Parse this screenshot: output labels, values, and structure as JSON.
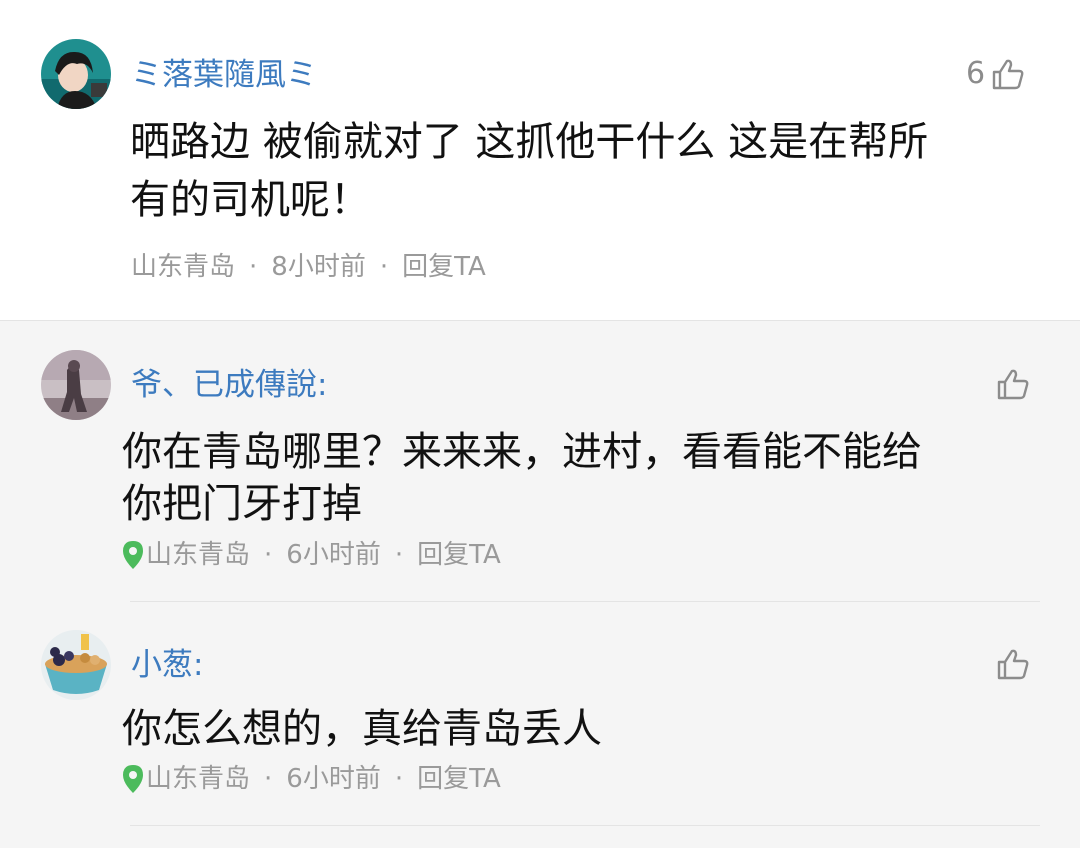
{
  "main_comment": {
    "username": "ミ落葉隨風ミ",
    "like_count": "6",
    "content_line1": "晒路边 被偷就对了 这抓他干什么 这是在帮所",
    "content_line2": "有的司机呢！",
    "location": "山东青岛",
    "separator": "·",
    "time": "8小时前",
    "reply_label": "回复TA"
  },
  "replies": [
    {
      "username": "爷、已成傳說:",
      "content_line1": "你在青岛哪里？来来来，进村，看看能不能给",
      "content_line2": "你把门牙打掉",
      "location": "山东青岛",
      "separator": "·",
      "time": "6小时前",
      "reply_label": "回复TA"
    },
    {
      "username": "小葱:",
      "content_line1": "你怎么想的，真给青岛丢人",
      "location": "山东青岛",
      "separator": "·",
      "time": "6小时前",
      "reply_label": "回复TA"
    }
  ],
  "colors": {
    "username": "#3d7bbf",
    "location_pin": "#4cbb5c",
    "reply_background": "#f5f5f5"
  },
  "icons": {
    "like": "thumbs-up-icon",
    "location": "location-pin-icon"
  }
}
